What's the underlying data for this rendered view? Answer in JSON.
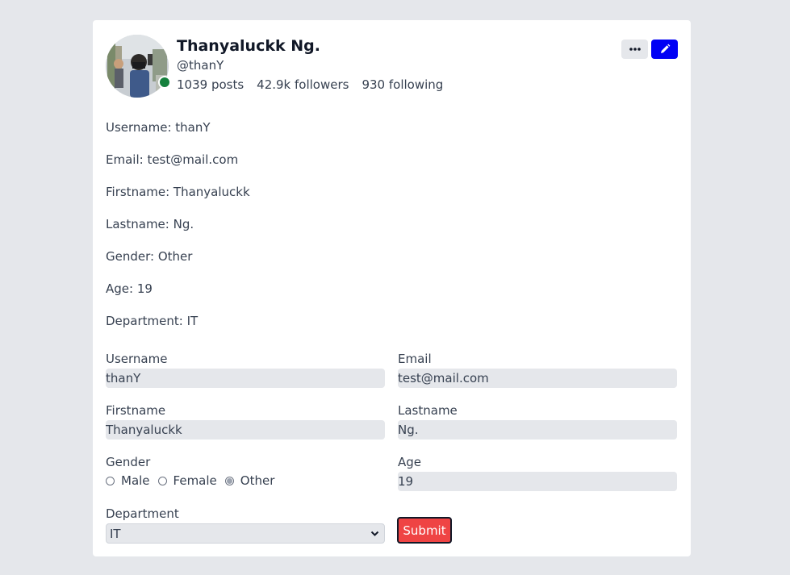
{
  "profile": {
    "display_name": "Thanyaluckk Ng.",
    "handle": "@thanY",
    "posts": "1039 posts",
    "followers": "42.9k followers",
    "following": "930 following",
    "online_color": "#15803d"
  },
  "header_actions": {
    "more_icon": "ellipsis-icon",
    "edit_icon": "pencil-icon",
    "edit_color": "#0000f5"
  },
  "info": {
    "username": "Username: thanY",
    "email": "Email: test@mail.com",
    "firstname": "Firstname: Thanyaluckk",
    "lastname": "Lastname: Ng.",
    "gender": "Gender: Other",
    "age": "Age: 19",
    "department": "Department: IT"
  },
  "form": {
    "username_label": "Username",
    "username_value": "thanY",
    "email_label": "Email",
    "email_value": "test@mail.com",
    "firstname_label": "Firstname",
    "firstname_value": "Thanyaluckk",
    "lastname_label": "Lastname",
    "lastname_value": "Ng.",
    "gender_label": "Gender",
    "gender_options": [
      "Male",
      "Female",
      "Other"
    ],
    "gender_selected": "Other",
    "age_label": "Age",
    "age_value": "19",
    "department_label": "Department",
    "department_value": "IT",
    "submit_label": "Submit",
    "submit_color": "#ef4444"
  }
}
